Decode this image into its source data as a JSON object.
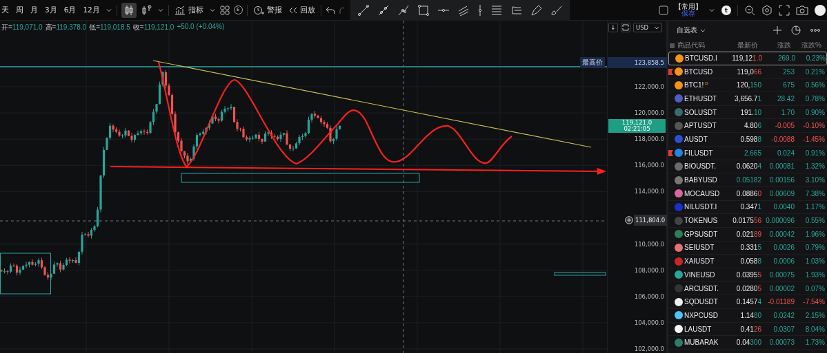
{
  "toolbar": {
    "timeframes": [
      "天",
      "周",
      "月",
      "3月",
      "6月",
      "12月"
    ],
    "indicators_label": "指标",
    "event_badge": "E",
    "alert_label": "警报",
    "replay_label": "回放",
    "layout_name": "【常用】",
    "save_label": "保存",
    "avatar_letter": "t"
  },
  "legend": {
    "items": [
      {
        "label": "开=",
        "value": "119,071.0"
      },
      {
        "label": "高=",
        "value": "119,378.0"
      },
      {
        "label": "低=",
        "value": "119,018.5"
      },
      {
        "label": "收=",
        "value": "119,121.0"
      }
    ],
    "change": "+50.0 (+0.04%)"
  },
  "chart_controls": {
    "scroll_glyph": "↓",
    "currency": "USD"
  },
  "price_axis": {
    "ticks": [
      "122,000.0",
      "120,000.0",
      "118,000.0",
      "116,000.0",
      "114,000.0",
      "110,000.0",
      "108,000.0",
      "106,000.0",
      "104,000.0",
      "102,000.0"
    ],
    "high_tag": {
      "label": "最高价",
      "value": "123,858.5"
    },
    "last_tag": {
      "value": "119,121.0",
      "countdown": "02:21:05"
    },
    "crosshair_tag": "111,804.0"
  },
  "watchlist": {
    "title": "自选表",
    "columns": [
      "商品代码",
      "最新价",
      "涨跌",
      "涨跌%"
    ],
    "rows": [
      {
        "symbol": "BTCUSD.I",
        "price_main": "119,12",
        "price_tail": "1.0",
        "tail_up": false,
        "change": "269.0",
        "pct": "0.23%",
        "up": true,
        "flagged": false,
        "selected": true,
        "color": "#f7931a"
      },
      {
        "symbol": "BTCUSD",
        "price_main": "119,0",
        "price_tail": "66",
        "tail_up": false,
        "change": "253",
        "pct": "0.21%",
        "up": true,
        "flagged": true,
        "selected": false,
        "color": "#f7931a"
      },
      {
        "symbol": "BTC1!",
        "badge": "D",
        "price_main": "120,",
        "price_tail": "150",
        "tail_up": true,
        "change": "675",
        "pct": "0.56%",
        "up": true,
        "flagged": false,
        "selected": false,
        "color": "#f7931a"
      },
      {
        "symbol": "ETHUSDT",
        "price_main": "3,656.7",
        "price_tail": "1",
        "tail_up": true,
        "change": "28.42",
        "pct": "0.78%",
        "up": true,
        "flagged": false,
        "selected": false,
        "color": "#4a5fc1"
      },
      {
        "symbol": "SOLUSDT",
        "price_main": "191.",
        "price_tail": "10",
        "tail_up": true,
        "change": "1.70",
        "pct": "0.90%",
        "up": true,
        "flagged": false,
        "selected": false,
        "color": "#3a6b70"
      },
      {
        "symbol": "APTUSDT",
        "price_main": "4.80",
        "price_tail": "6",
        "tail_up": true,
        "change": "-0.005",
        "pct": "-0.10%",
        "up": false,
        "flagged": false,
        "selected": false,
        "color": "#555555"
      },
      {
        "symbol": "AUSDT",
        "price_main": "0.598",
        "price_tail": "8",
        "tail_up": true,
        "change": "-0.0088",
        "pct": "-1.45%",
        "up": false,
        "flagged": false,
        "selected": false,
        "color": "#2d4fd6"
      },
      {
        "symbol": "FILUSDT",
        "price_tail": "2.665",
        "tail_up": true,
        "change": "0.024",
        "pct": "0.91%",
        "up": true,
        "flagged": true,
        "selected": false,
        "color": "#1e88e5"
      },
      {
        "symbol": "BIOUSDT.",
        "price_main": "0.0620",
        "price_tail": "4",
        "tail_up": true,
        "change": "0.00081",
        "pct": "1.32%",
        "up": true,
        "flagged": false,
        "selected": false,
        "color": "#6b6b6b"
      },
      {
        "symbol": "BABYUSD",
        "price_tail": "0.05182",
        "tail_up": true,
        "change": "0.00156",
        "pct": "3.10%",
        "up": true,
        "flagged": false,
        "selected": false,
        "color": "#777777"
      },
      {
        "symbol": "MOCAUSD",
        "price_main": "0.0886",
        "price_tail": "0",
        "tail_up": false,
        "change": "0.00609",
        "pct": "7.38%",
        "up": true,
        "flagged": false,
        "selected": false,
        "color": "#d9669e"
      },
      {
        "symbol": "NILUSDT.I",
        "price_main": "0.347",
        "price_tail": "1",
        "tail_up": true,
        "change": "0.0040",
        "pct": "1.17%",
        "up": true,
        "flagged": false,
        "selected": false,
        "color": "#1a2fd0"
      },
      {
        "symbol": "TOKENUS",
        "price_main": "0.0175",
        "price_tail": "56",
        "tail_up": false,
        "change": "0.000096",
        "pct": "0.55%",
        "up": true,
        "flagged": false,
        "selected": false,
        "color": "#444444"
      },
      {
        "symbol": "GPSUSDT",
        "price_main": "0.021",
        "price_tail": "89",
        "tail_up": false,
        "change": "0.00042",
        "pct": "1.96%",
        "up": true,
        "flagged": false,
        "selected": false,
        "color": "#2e7d5b"
      },
      {
        "symbol": "SEIUSDT",
        "price_main": "0.331",
        "price_tail": "5",
        "tail_up": true,
        "change": "0.0026",
        "pct": "0.79%",
        "up": true,
        "flagged": false,
        "selected": false,
        "color": "#e57373"
      },
      {
        "symbol": "XAIUSDT",
        "price_main": "0.058",
        "price_tail": "8",
        "tail_up": true,
        "change": "0.0006",
        "pct": "1.03%",
        "up": true,
        "flagged": false,
        "selected": false,
        "color": "#c62828"
      },
      {
        "symbol": "VINEUSD",
        "price_main": "0.0395",
        "price_tail": "5",
        "tail_up": false,
        "change": "0.00075",
        "pct": "1.93%",
        "up": true,
        "flagged": false,
        "selected": false,
        "color": "#26a69a"
      },
      {
        "symbol": "ARCUSDT.",
        "price_main": "0.0280",
        "price_tail": "5",
        "tail_up": false,
        "change": "0.00002",
        "pct": "0.07%",
        "up": true,
        "flagged": false,
        "selected": false,
        "color": "#333333"
      },
      {
        "symbol": "SQDUSDT",
        "price_main": "0.1457",
        "price_tail": "4",
        "tail_up": true,
        "change": "-0.01189",
        "pct": "-7.54%",
        "up": false,
        "flagged": false,
        "selected": false,
        "color": "#eeeeee"
      },
      {
        "symbol": "NXPCUSD",
        "price_main": "1.14",
        "price_tail": "80",
        "tail_up": true,
        "change": "0.0242",
        "pct": "2.15%",
        "up": true,
        "flagged": false,
        "selected": false,
        "color": "#4fc3f7"
      },
      {
        "symbol": "LAUSDT",
        "price_main": "0.41",
        "price_tail": "26",
        "tail_up": false,
        "change": "0.0307",
        "pct": "8.04%",
        "up": true,
        "flagged": false,
        "selected": false,
        "color": "#f5f5f5"
      },
      {
        "symbol": "MUBARAK",
        "price_main": "0.04",
        "price_tail": "300",
        "tail_up": true,
        "change": "0.00073",
        "pct": "1.73%",
        "up": true,
        "flagged": false,
        "selected": false,
        "color": "#2e7d6b"
      }
    ]
  }
}
